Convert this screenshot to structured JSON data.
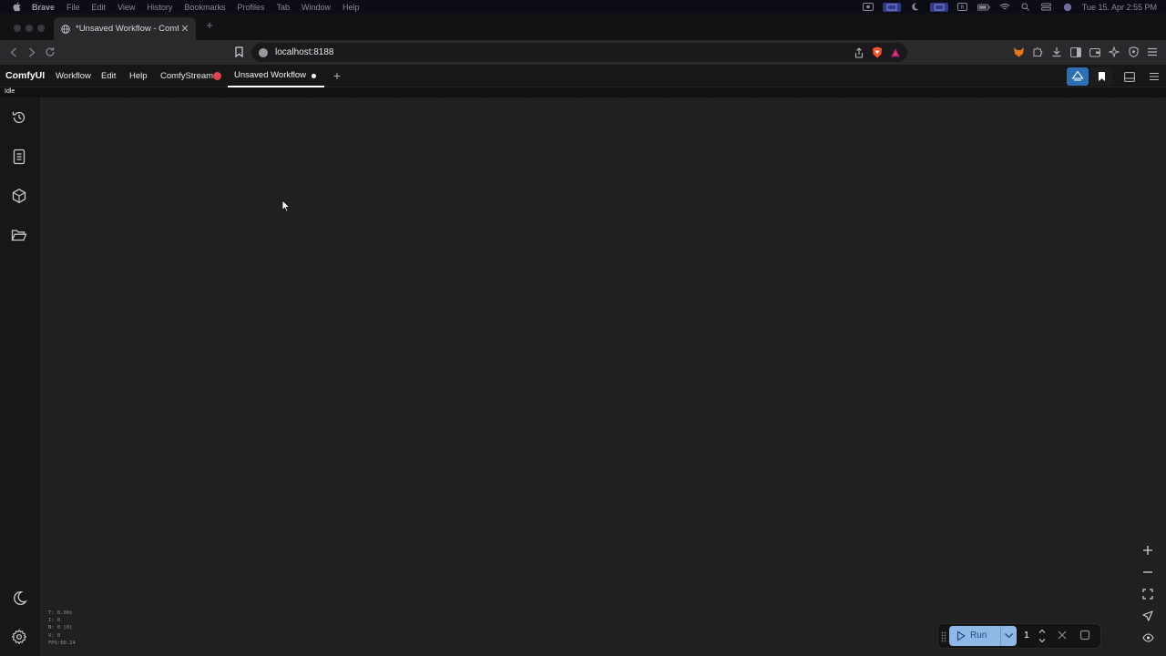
{
  "macos_menubar": {
    "app_name": "Brave",
    "items": [
      "File",
      "Edit",
      "View",
      "History",
      "Bookmarks",
      "Profiles",
      "Tab",
      "Window",
      "Help"
    ],
    "clock": "Tue 15. Apr 2:55 PM"
  },
  "browser": {
    "tab_title": "*Unsaved Workflow - Comfy",
    "url": "localhost:8188"
  },
  "comfy": {
    "logo": "ComfyUI",
    "menu": {
      "workflow": "Workflow",
      "edit": "Edit",
      "help": "Help",
      "comfystream": "ComfyStream"
    },
    "workflow_tab": "Unsaved Workflow",
    "status": "Idle"
  },
  "canvas_stats": {
    "t": "T: 0.00s",
    "i": "I: 0",
    "n": "N: 0 [0]",
    "v": "V: 0",
    "fps": "FPS:60.24"
  },
  "run_bar": {
    "run_label": "Run",
    "batch_count": "1"
  },
  "colors": {
    "accent": "#2d6fb3",
    "run_button": "#8fb8e6",
    "record_dot": "#e2434f",
    "canvas": "#202020"
  }
}
